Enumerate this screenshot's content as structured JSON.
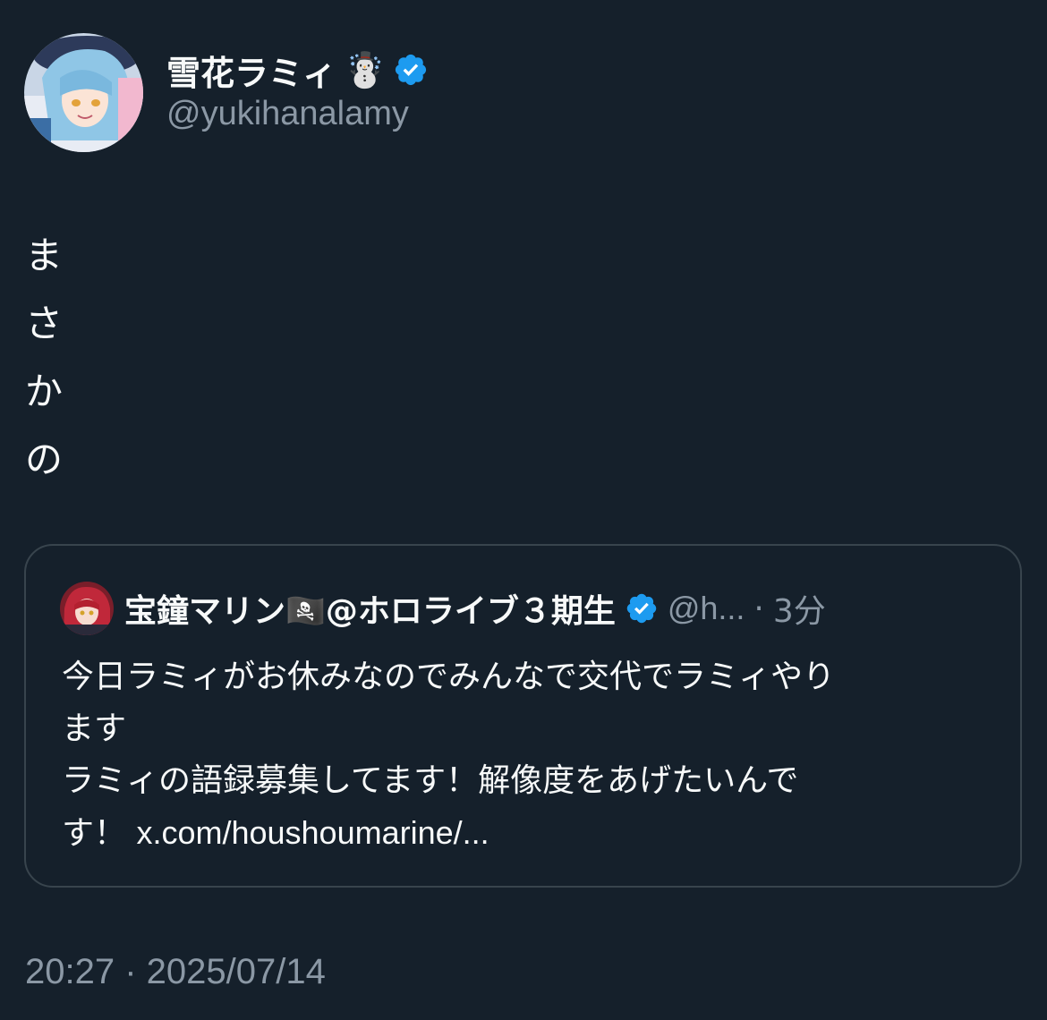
{
  "author": {
    "display_name": "雪花ラミィ",
    "name_emoji": "☃️",
    "handle": "@yukihanalamy",
    "verified": true,
    "badge_color": "#1d9bf0"
  },
  "tweet": {
    "text_lines": [
      "ま",
      "さ",
      "か",
      "の"
    ]
  },
  "quoted_tweet": {
    "display_name": "宝鐘マリン🏴‍☠️@ホロライブ３期生",
    "handle": "@h...",
    "separator": "·",
    "time_ago": "3分",
    "verified": true,
    "text_lines": [
      "今日ラミィがお休みなのでみんなで交代でラミィやり",
      "ます",
      "ラミィの語録募集してます！解像度をあげたいんで"
    ],
    "last_line_prefix": "す！ ",
    "link_text": "x.com/houshoumarine/..."
  },
  "timestamp": "20:27 · 2025/07/14",
  "colors": {
    "background": "#15202b",
    "text_primary": "#f7f9f9",
    "text_secondary": "#8b98a5",
    "border": "#38444d",
    "accent": "#1d9bf0"
  }
}
